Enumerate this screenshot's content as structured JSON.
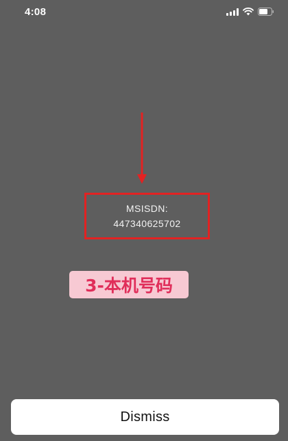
{
  "status_bar": {
    "time": "4:08",
    "icons": [
      "cellular-signal-icon",
      "wifi-icon",
      "battery-icon"
    ]
  },
  "alert": {
    "label": "MSISDN:",
    "value": "447340625702"
  },
  "annotation": {
    "text": "3-本机号码"
  },
  "dismiss_button": {
    "label": "Dismiss"
  },
  "colors": {
    "background": "#5e5e5e",
    "highlight_border": "#e32222",
    "annotation_bg": "#f7c9d3",
    "annotation_text": "#e02e5a",
    "button_bg": "#ffffff"
  }
}
